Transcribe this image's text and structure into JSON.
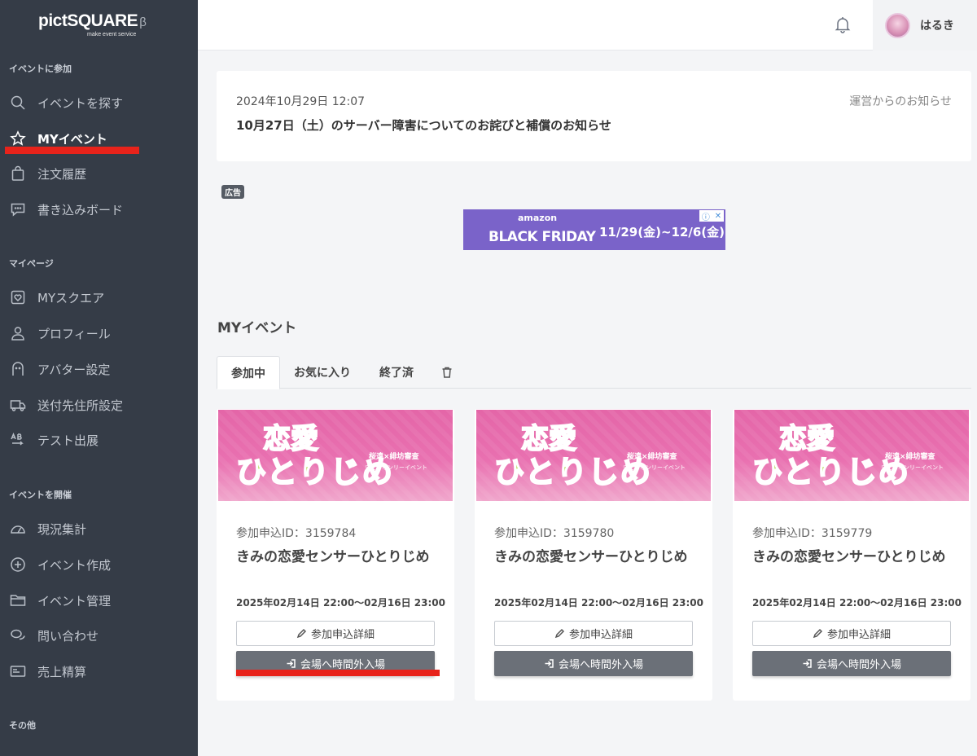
{
  "app": {
    "brand": "pictSQUARE",
    "beta": "β",
    "tagline": "make event service"
  },
  "sidebar": {
    "sections": [
      {
        "title": "イベントに参加",
        "items": [
          {
            "label": "イベントを探す",
            "icon": "search-icon"
          },
          {
            "label": "MYイベント",
            "icon": "star-icon",
            "active": true
          },
          {
            "label": "注文履歴",
            "icon": "bag-icon"
          },
          {
            "label": "書き込みボード",
            "icon": "chat-icon"
          }
        ]
      },
      {
        "title": "マイページ",
        "items": [
          {
            "label": "MYスクエア",
            "icon": "heart-frame-icon"
          },
          {
            "label": "プロフィール",
            "icon": "user-icon"
          },
          {
            "label": "アバター設定",
            "icon": "avatar-icon"
          },
          {
            "label": "送付先住所設定",
            "icon": "truck-icon"
          },
          {
            "label": "テスト出展",
            "icon": "ab-icon"
          }
        ]
      },
      {
        "title": "イベントを開催",
        "items": [
          {
            "label": "現況集計",
            "icon": "gauge-icon"
          },
          {
            "label": "イベント作成",
            "icon": "plus-circle-icon"
          },
          {
            "label": "イベント管理",
            "icon": "folder-icon"
          },
          {
            "label": "問い合わせ",
            "icon": "chats-icon"
          },
          {
            "label": "売上精算",
            "icon": "card-icon"
          }
        ]
      },
      {
        "title": "その他",
        "items": []
      }
    ]
  },
  "header": {
    "username": "はるき",
    "bell_icon": "bell-icon"
  },
  "notice": {
    "date": "2024年10月29日 12:07",
    "source": "運営からのお知らせ",
    "title": "10月27日（土）のサーバー障害についてのお詫びと補償のお知らせ"
  },
  "ad": {
    "badge": "広告",
    "amazon": "amazon",
    "headline": "BLACK FRIDAY",
    "dates": "11/29(金)~12/6(金)"
  },
  "my_events": {
    "heading": "MYイベント",
    "tabs": [
      {
        "label": "参加中",
        "active": true
      },
      {
        "label": "お気に入り"
      },
      {
        "label": "終了済"
      }
    ],
    "cards": [
      {
        "app_id": "参加申込ID：3159784",
        "name": "きみの恋愛センサーひとりじめ",
        "date": "2025年02月14日 22:00〜02月16日 23:00",
        "detail_btn": "参加申込詳細",
        "enter_btn": "会場へ時間外入場"
      },
      {
        "app_id": "参加申込ID：3159780",
        "name": "きみの恋愛センサーひとりじめ",
        "date": "2025年02月14日 22:00〜02月16日 23:00",
        "detail_btn": "参加申込詳細",
        "enter_btn": "会場へ時間外入場"
      },
      {
        "app_id": "参加申込ID：3159779",
        "name": "きみの恋愛センサーひとりじめ",
        "date": "2025年02月14日 22:00〜02月16日 23:00",
        "detail_btn": "参加申込詳細",
        "enter_btn": "会場へ時間外入場"
      }
    ],
    "banner_text": {
      "line1": "恋愛",
      "line2": "ひとりじめ",
      "tag": "桜遠×緋坊審査",
      "tag2": "ウェブオンリーイベント"
    }
  },
  "colors": {
    "sidebar_bg": "#353c47",
    "accent_red": "#e8231b",
    "button_dark": "#6b7078",
    "banner_pink": "#e466a8"
  }
}
